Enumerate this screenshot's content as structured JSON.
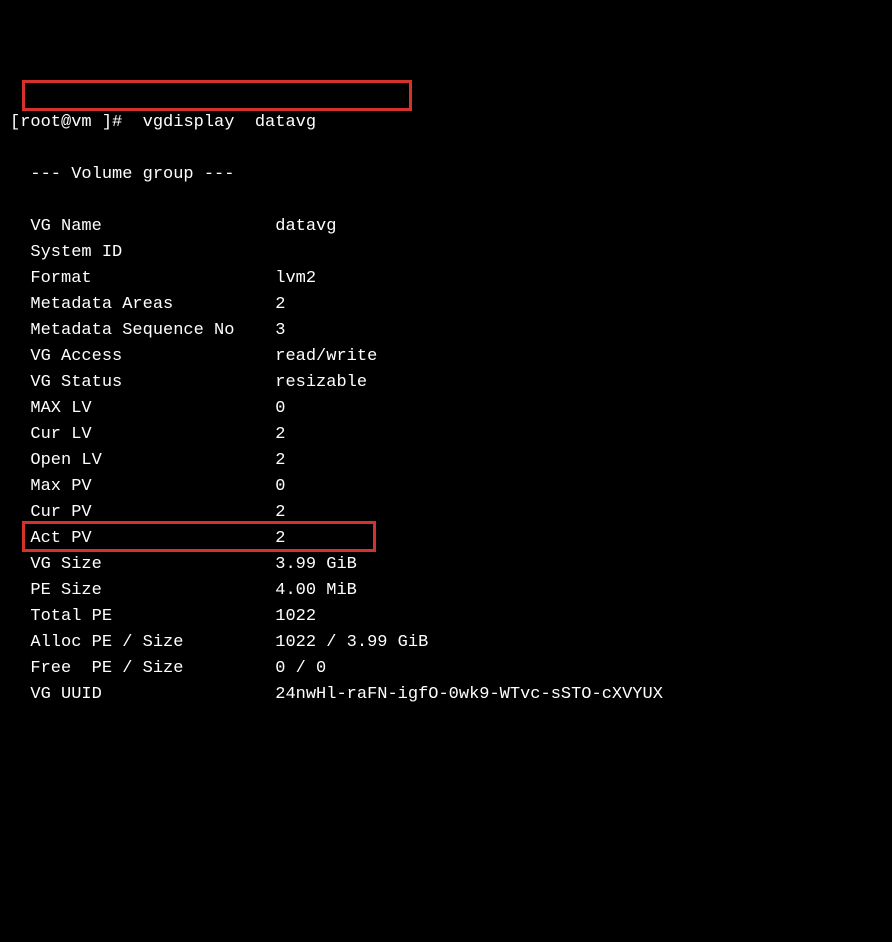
{
  "prompt": {
    "user": "root",
    "host": "vm",
    "command": "vgdisplay  datavg"
  },
  "section_header": "  --- Volume group ---",
  "fields": [
    {
      "label": "VG Name",
      "value": "datavg"
    },
    {
      "label": "System ID",
      "value": ""
    },
    {
      "label": "Format",
      "value": "lvm2"
    },
    {
      "label": "Metadata Areas",
      "value": "2"
    },
    {
      "label": "Metadata Sequence No",
      "value": "3"
    },
    {
      "label": "VG Access",
      "value": "read/write"
    },
    {
      "label": "VG Status",
      "value": "resizable"
    },
    {
      "label": "MAX LV",
      "value": "0"
    },
    {
      "label": "Cur LV",
      "value": "2"
    },
    {
      "label": "Open LV",
      "value": "2"
    },
    {
      "label": "Max PV",
      "value": "0"
    },
    {
      "label": "Cur PV",
      "value": "2"
    },
    {
      "label": "Act PV",
      "value": "2"
    },
    {
      "label": "VG Size",
      "value": "3.99 GiB"
    },
    {
      "label": "PE Size",
      "value": "4.00 MiB"
    },
    {
      "label": "Total PE",
      "value": "1022"
    },
    {
      "label": "Alloc PE / Size",
      "value": "1022 / 3.99 GiB"
    },
    {
      "label": "Free  PE / Size",
      "value": "0 / 0"
    },
    {
      "label": "VG UUID",
      "value": "24nwHl-raFN-igfO-0wk9-WTvc-sSTO-cXVYUX"
    }
  ],
  "highlights": {
    "hl1": {
      "annotates": "VG Name row"
    },
    "hl2": {
      "annotates": "Free PE / Size row"
    }
  }
}
